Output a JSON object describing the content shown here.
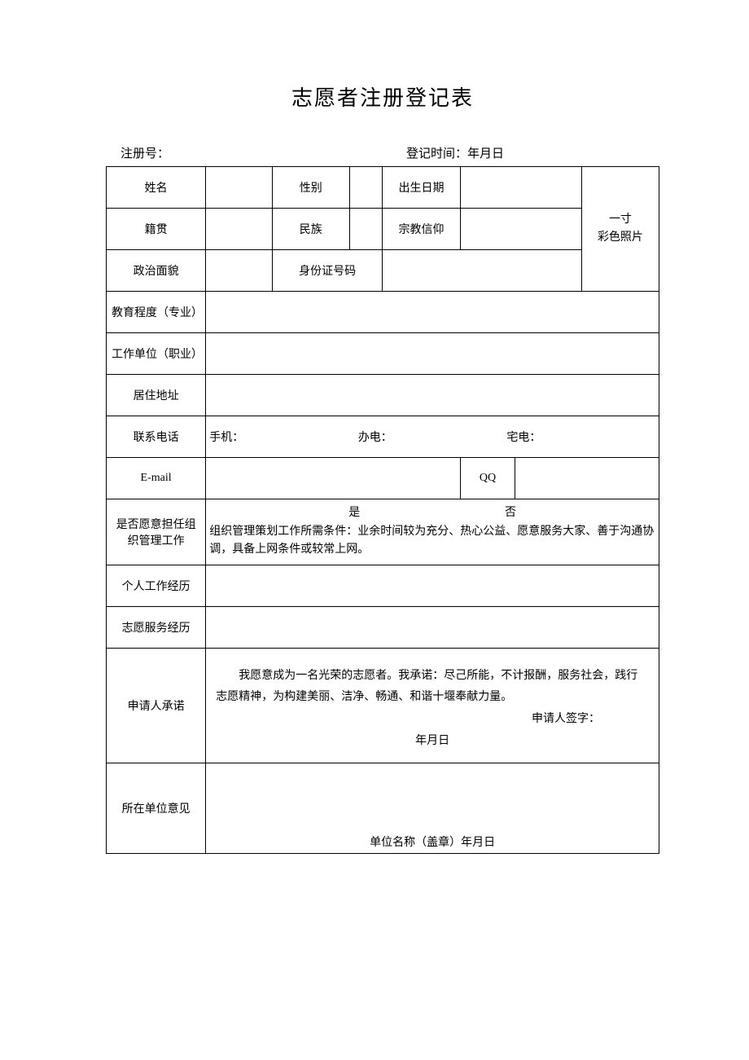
{
  "title": "志愿者注册登记表",
  "header": {
    "reg_label": "注册号：",
    "date_label": "登记时间：年月日"
  },
  "labels": {
    "name": "姓名",
    "gender": "性别",
    "birth": "出生日期",
    "native": "籍贯",
    "ethnic": "民族",
    "religion": "宗教信仰",
    "political": "政治面貌",
    "id_no": "身份证号码",
    "education": "教育程度（专业）",
    "work_unit": "工作单位（职业）",
    "address": "居住地址",
    "phone": "联系电话",
    "email": "E-mail",
    "qq": "QQ",
    "willing": "是否愿意担任组织管理工作",
    "work_history": "个人工作经历",
    "volunteer_history": "志愿服务经历",
    "pledge": "申请人承诺",
    "unit_opinion": "所在单位意见",
    "photo_line1": "一寸",
    "photo_line2": "彩色照片"
  },
  "phone": {
    "mobile": "手机：",
    "office": "办电：",
    "home": "宅电："
  },
  "willing": {
    "yes": "是",
    "no": "否",
    "note": "组织管理策划工作所需条件：业余时间较为充分、热心公益、愿意服务大家、善于沟通协调，具备上网条件或较常上网。"
  },
  "pledge": {
    "text": "我愿意成为一名光荣的志愿者。我承诺：尽己所能，不计报酬，服务社会，践行志愿精神，为构建美丽、洁净、畅通、和谐十堰奉献力量。",
    "sign": "申请人签字：",
    "date": "年月日"
  },
  "unit": {
    "stamp": "单位名称（盖章）年月日"
  }
}
